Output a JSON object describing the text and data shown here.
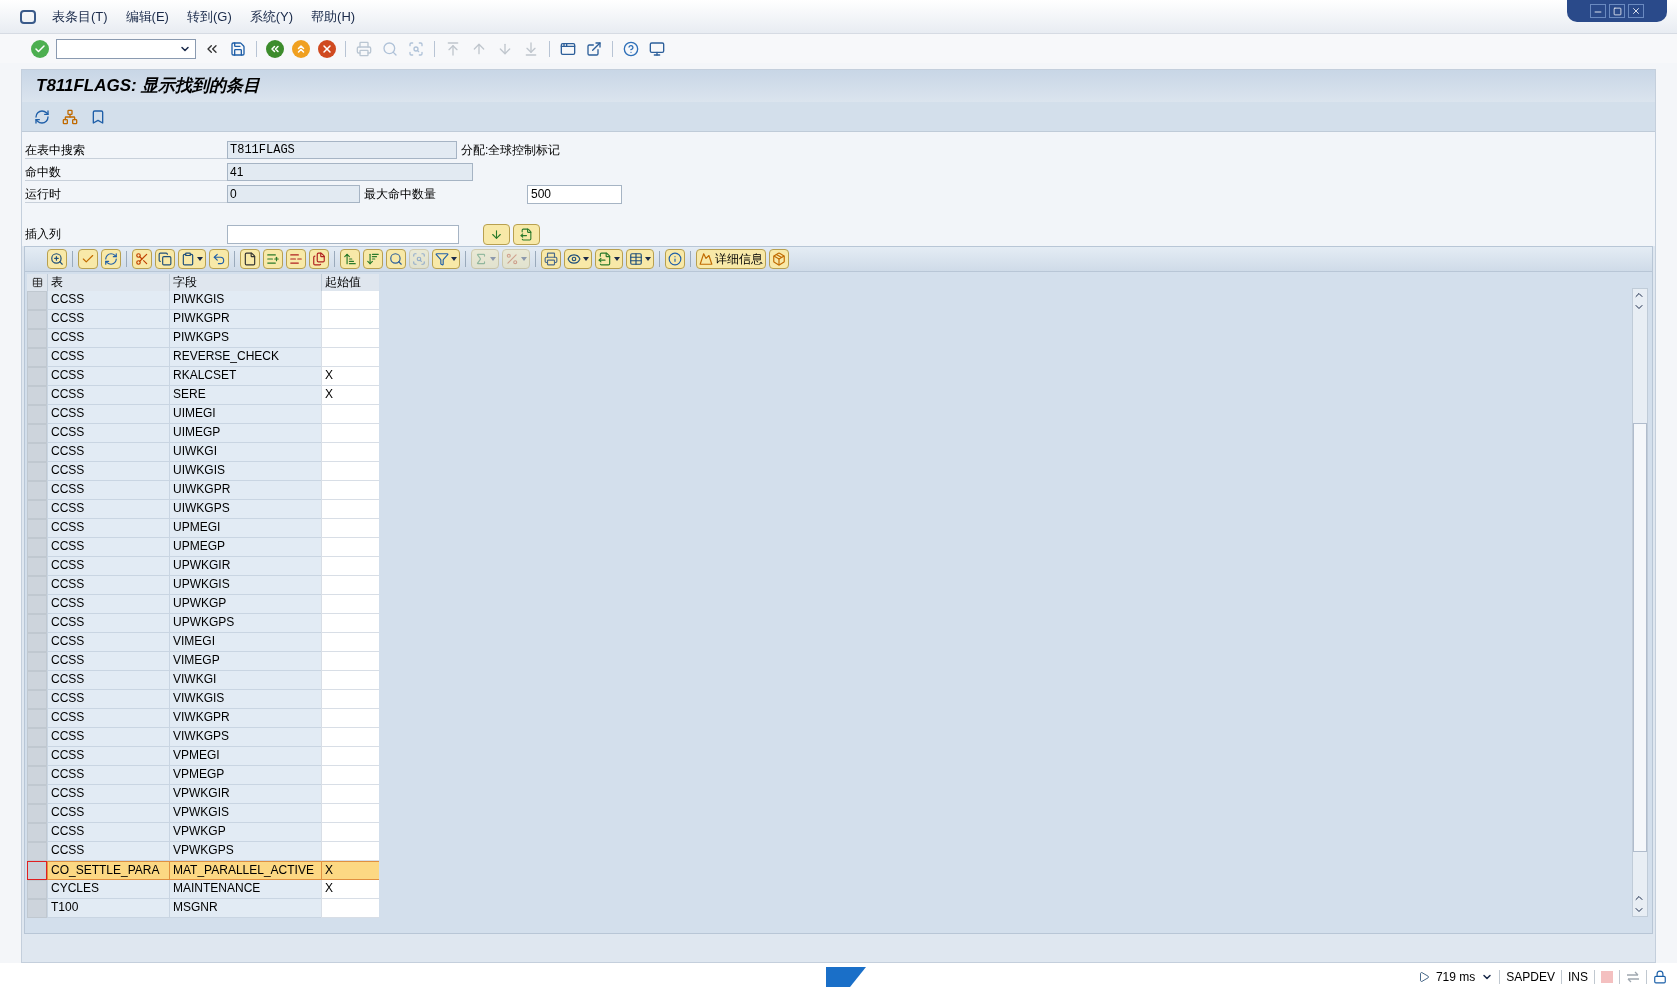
{
  "menu": [
    "表条目(T)",
    "编辑(E)",
    "转到(G)",
    "系统(Y)",
    "帮助(H)"
  ],
  "toolbar": [
    {
      "kind": "enter",
      "disabled": false
    },
    {
      "kind": "command_field"
    },
    {
      "kind": "collapse",
      "disabled": false
    },
    {
      "kind": "save",
      "disabled": false
    },
    {
      "kind": "sep"
    },
    {
      "kind": "back",
      "disabled": false
    },
    {
      "kind": "exit",
      "disabled": false
    },
    {
      "kind": "cancel",
      "disabled": false
    },
    {
      "kind": "sep"
    },
    {
      "kind": "print",
      "disabled": true
    },
    {
      "kind": "find",
      "disabled": true
    },
    {
      "kind": "findnext",
      "disabled": true
    },
    {
      "kind": "sep"
    },
    {
      "kind": "first",
      "disabled": true
    },
    {
      "kind": "prev",
      "disabled": true
    },
    {
      "kind": "next",
      "disabled": true
    },
    {
      "kind": "last",
      "disabled": true
    },
    {
      "kind": "sep"
    },
    {
      "kind": "newsession",
      "disabled": false
    },
    {
      "kind": "shortcut",
      "disabled": false
    },
    {
      "kind": "sep"
    },
    {
      "kind": "help",
      "disabled": false
    },
    {
      "kind": "customize",
      "disabled": false
    }
  ],
  "title": "T811FLAGS:  显示找到的条目",
  "app_toolbar": [
    {
      "kind": "refresh"
    },
    {
      "kind": "tree"
    },
    {
      "kind": "bookmark"
    }
  ],
  "fields": {
    "search_label": "在表中搜索",
    "search_value": "T811FLAGS",
    "search_desc": "分配:全球控制标记",
    "hits_label": "命中数",
    "hits_value": "41",
    "runtime_label": "运行时",
    "runtime_value": "0",
    "max_label": "最大命中数量",
    "max_value": "500",
    "insert_label": "插入列"
  },
  "alv_toolbar": [
    {
      "kind": "detail",
      "disabled": false
    },
    {
      "kind": "sep"
    },
    {
      "kind": "choose",
      "disabled": false
    },
    {
      "kind": "refresh",
      "disabled": false
    },
    {
      "kind": "sep"
    },
    {
      "kind": "cut",
      "disabled": false
    },
    {
      "kind": "copy",
      "disabled": false
    },
    {
      "kind": "paste",
      "disabled": false,
      "dropdown": true
    },
    {
      "kind": "undo",
      "disabled": false
    },
    {
      "kind": "sep"
    },
    {
      "kind": "new",
      "disabled": false
    },
    {
      "kind": "insert",
      "disabled": false
    },
    {
      "kind": "delete",
      "disabled": false
    },
    {
      "kind": "duplicate",
      "disabled": false
    },
    {
      "kind": "sep"
    },
    {
      "kind": "sortasc",
      "disabled": false
    },
    {
      "kind": "sortdesc",
      "disabled": false
    },
    {
      "kind": "find",
      "disabled": false
    },
    {
      "kind": "findnext",
      "disabled": true
    },
    {
      "kind": "filter",
      "disabled": false,
      "dropdown": true
    },
    {
      "kind": "sep"
    },
    {
      "kind": "sum",
      "disabled": true,
      "dropdown": true
    },
    {
      "kind": "subtotal",
      "disabled": true,
      "dropdown": true
    },
    {
      "kind": "sep"
    },
    {
      "kind": "print",
      "disabled": false
    },
    {
      "kind": "view",
      "disabled": false,
      "dropdown": true
    },
    {
      "kind": "export",
      "disabled": false,
      "dropdown": true
    },
    {
      "kind": "layout",
      "disabled": false,
      "dropdown": true
    },
    {
      "kind": "sep"
    },
    {
      "kind": "info",
      "disabled": false
    },
    {
      "kind": "sep"
    },
    {
      "kind": "details",
      "disabled": false,
      "label": "详细信息"
    },
    {
      "kind": "package",
      "disabled": false
    }
  ],
  "table": {
    "columns": [
      "表",
      "字段",
      "起始值"
    ],
    "rows": [
      {
        "table": "CCSS",
        "field": "PIWKGIS",
        "value": "",
        "selected": false
      },
      {
        "table": "CCSS",
        "field": "PIWKGPR",
        "value": "",
        "selected": false
      },
      {
        "table": "CCSS",
        "field": "PIWKGPS",
        "value": "",
        "selected": false
      },
      {
        "table": "CCSS",
        "field": "REVERSE_CHECK",
        "value": "",
        "selected": false
      },
      {
        "table": "CCSS",
        "field": "RKALCSET",
        "value": "X",
        "selected": false
      },
      {
        "table": "CCSS",
        "field": "SERE",
        "value": "X",
        "selected": false
      },
      {
        "table": "CCSS",
        "field": "UIMEGI",
        "value": "",
        "selected": false
      },
      {
        "table": "CCSS",
        "field": "UIMEGP",
        "value": "",
        "selected": false
      },
      {
        "table": "CCSS",
        "field": "UIWKGI",
        "value": "",
        "selected": false
      },
      {
        "table": "CCSS",
        "field": "UIWKGIS",
        "value": "",
        "selected": false
      },
      {
        "table": "CCSS",
        "field": "UIWKGPR",
        "value": "",
        "selected": false
      },
      {
        "table": "CCSS",
        "field": "UIWKGPS",
        "value": "",
        "selected": false
      },
      {
        "table": "CCSS",
        "field": "UPMEGI",
        "value": "",
        "selected": false
      },
      {
        "table": "CCSS",
        "field": "UPMEGP",
        "value": "",
        "selected": false
      },
      {
        "table": "CCSS",
        "field": "UPWKGIR",
        "value": "",
        "selected": false
      },
      {
        "table": "CCSS",
        "field": "UPWKGIS",
        "value": "",
        "selected": false
      },
      {
        "table": "CCSS",
        "field": "UPWKGP",
        "value": "",
        "selected": false
      },
      {
        "table": "CCSS",
        "field": "UPWKGPS",
        "value": "",
        "selected": false
      },
      {
        "table": "CCSS",
        "field": "VIMEGI",
        "value": "",
        "selected": false
      },
      {
        "table": "CCSS",
        "field": "VIMEGP",
        "value": "",
        "selected": false
      },
      {
        "table": "CCSS",
        "field": "VIWKGI",
        "value": "",
        "selected": false
      },
      {
        "table": "CCSS",
        "field": "VIWKGIS",
        "value": "",
        "selected": false
      },
      {
        "table": "CCSS",
        "field": "VIWKGPR",
        "value": "",
        "selected": false
      },
      {
        "table": "CCSS",
        "field": "VIWKGPS",
        "value": "",
        "selected": false
      },
      {
        "table": "CCSS",
        "field": "VPMEGI",
        "value": "",
        "selected": false
      },
      {
        "table": "CCSS",
        "field": "VPMEGP",
        "value": "",
        "selected": false
      },
      {
        "table": "CCSS",
        "field": "VPWKGIR",
        "value": "",
        "selected": false
      },
      {
        "table": "CCSS",
        "field": "VPWKGIS",
        "value": "",
        "selected": false
      },
      {
        "table": "CCSS",
        "field": "VPWKGP",
        "value": "",
        "selected": false
      },
      {
        "table": "CCSS",
        "field": "VPWKGPS",
        "value": "",
        "selected": false
      },
      {
        "table": "CO_SETTLE_PARA",
        "field": "MAT_PARALLEL_ACTIVE",
        "value": "X",
        "selected": true
      },
      {
        "table": "CYCLES",
        "field": "MAINTENANCE",
        "value": "X",
        "selected": false
      },
      {
        "table": "T100",
        "field": "MSGNR",
        "value": "",
        "selected": false
      }
    ]
  },
  "status_bar": {
    "runtime": "719 ms",
    "system": "SAPDEV",
    "mode": "INS"
  }
}
